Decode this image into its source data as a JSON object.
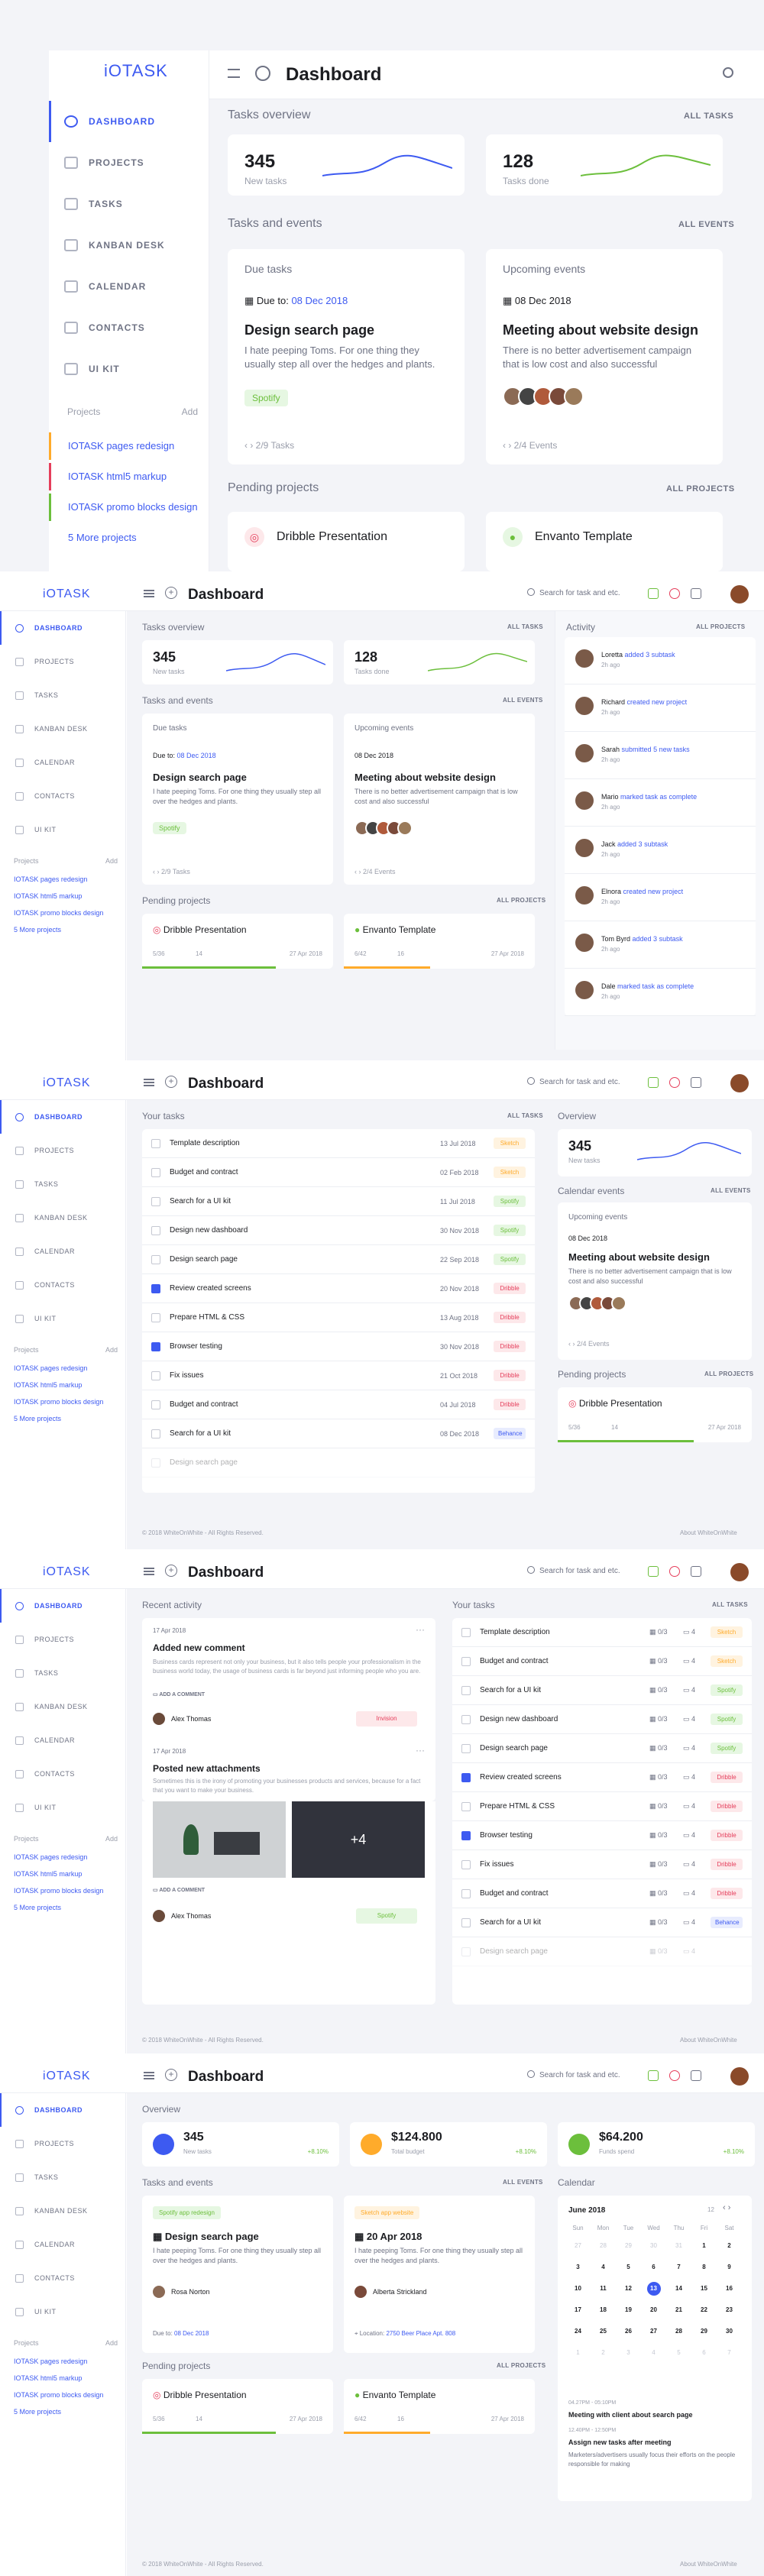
{
  "app": {
    "logo": "iOTASK"
  },
  "nav": {
    "dashboard": "DASHBOARD",
    "projects": "PROJECTS",
    "tasks": "TASKS",
    "kanban": "KANBAN DESK",
    "calendar": "CALENDAR",
    "contacts": "CONTACTS",
    "uikit": "UI KIT"
  },
  "sidebar": {
    "projects_label": "Projects",
    "add_label": "Add",
    "projects": [
      "IOTASK pages redesign",
      "IOTASK html5 markup",
      "IOTASK promo blocks design"
    ],
    "more": "5 More projects"
  },
  "header": {
    "title": "Dashboard",
    "search_placeholder": "Search for task and etc."
  },
  "overview": {
    "title": "Tasks overview",
    "link": "ALL TASKS",
    "new_tasks": {
      "value": "345",
      "label": "New tasks"
    },
    "tasks_done": {
      "value": "128",
      "label": "Tasks done"
    }
  },
  "events": {
    "title": "Tasks and events",
    "link": "ALL EVENTS",
    "due": {
      "heading": "Due tasks",
      "due_label": "Due to:",
      "due_date": "08 Dec 2018",
      "name": "Design search page",
      "desc": "I hate peeping Toms. For one thing they usually step all over the hedges and plants.",
      "tag": "Spotify",
      "pager": "2/9 Tasks"
    },
    "upcoming": {
      "heading": "Upcoming events",
      "date": "08 Dec 2018",
      "name": "Meeting about website design",
      "desc": "There is no better advertisement campaign that is low cost and also successful",
      "pager": "2/4 Events"
    }
  },
  "pending": {
    "title": "Pending projects",
    "link": "ALL PROJECTS",
    "items": [
      {
        "name": "Dribble Presentation",
        "files": "5/36",
        "comments": "14",
        "date": "27 Apr 2018"
      },
      {
        "name": "Envanto Template",
        "files": "6/42",
        "comments": "16",
        "date": "27 Apr 2018"
      }
    ]
  },
  "activity": {
    "title": "Activity",
    "filter": "ALL PROJECTS",
    "items": [
      {
        "name": "Loretta",
        "action": "added 3 subtask",
        "time": "2h ago"
      },
      {
        "name": "Richard",
        "action": "created new project",
        "time": "2h ago"
      },
      {
        "name": "Sarah",
        "action": "submitted 5 new tasks",
        "time": "2h ago"
      },
      {
        "name": "Mario",
        "action": "marked task as complete",
        "time": "2h ago"
      },
      {
        "name": "Jack",
        "action": "added 3 subtask",
        "time": "2h ago"
      },
      {
        "name": "Elnora",
        "action": "created new project",
        "time": "2h ago"
      },
      {
        "name": "Tom Byrd",
        "action": "added 3 subtask",
        "time": "2h ago"
      },
      {
        "name": "Dale",
        "action": "marked task as complete",
        "time": "2h ago"
      }
    ]
  },
  "footer": {
    "copy": "© 2018 WhiteOnWhite - All Rights Reserved.",
    "about": "About WhiteOnWhite"
  },
  "your_tasks": {
    "title": "Your tasks",
    "link": "ALL TASKS",
    "items": [
      {
        "name": "Template description",
        "date": "13 Jul 2018",
        "tag": "Sketch",
        "color": "orange",
        "checked": false
      },
      {
        "name": "Budget and contract",
        "date": "02 Feb 2018",
        "tag": "Sketch",
        "color": "orange",
        "checked": false
      },
      {
        "name": "Search for a UI kit",
        "date": "11 Jul 2018",
        "tag": "Spotify",
        "color": "green",
        "checked": false
      },
      {
        "name": "Design new dashboard",
        "date": "30 Nov 2018",
        "tag": "Spotify",
        "color": "green",
        "checked": false
      },
      {
        "name": "Design search page",
        "date": "22 Sep 2018",
        "tag": "Spotify",
        "color": "green",
        "checked": false
      },
      {
        "name": "Review created screens",
        "date": "20 Nov 2018",
        "tag": "Dribble",
        "color": "red",
        "checked": true
      },
      {
        "name": "Prepare HTML & CSS",
        "date": "13 Aug 2018",
        "tag": "Dribble",
        "color": "red",
        "checked": false
      },
      {
        "name": "Browser testing",
        "date": "30 Nov 2018",
        "tag": "Dribble",
        "color": "red",
        "checked": true
      },
      {
        "name": "Fix issues",
        "date": "21 Oct 2018",
        "tag": "Dribble",
        "color": "red",
        "checked": false
      },
      {
        "name": "Budget and contract",
        "date": "04 Jul 2018",
        "tag": "Dribble",
        "color": "red",
        "checked": false
      },
      {
        "name": "Search for a UI kit",
        "date": "08 Dec 2018",
        "tag": "Behance",
        "color": "blue",
        "checked": false
      },
      {
        "name": "Design search page",
        "date": "",
        "tag": "",
        "color": "green",
        "checked": false
      }
    ]
  },
  "side_overview": {
    "title": "Overview",
    "value": "345",
    "label": "New tasks",
    "cal_title": "Calendar events"
  },
  "recent": {
    "title": "Recent activity",
    "date1": "17 Apr 2018",
    "h1": "Added new comment",
    "p1": "Business cards represent not only your business, but it also tells people your professionalism in the business world today, the usage of business cards is far beyond just informing people who you are.",
    "add_comment": "ADD A COMMENT",
    "user": "Alex Thomas",
    "tag1": "Invision",
    "date2": "17 Apr 2018",
    "h2": "Posted new attachments",
    "p2": "Sometimes this is the irony of promoting your businesses products and services, because for a fact that you want to make your business.",
    "more_imgs": "+4",
    "tag2": "Spotify",
    "subtask_count": "0/3",
    "comment_count": "4"
  },
  "overview5": {
    "title": "Overview",
    "stats": [
      {
        "value": "345",
        "label": "New tasks",
        "delta": "+8.10%",
        "color": "#3d5af1"
      },
      {
        "value": "$124.800",
        "label": "Total budget",
        "delta": "+8.10%",
        "color": "#ffab2b"
      },
      {
        "value": "$64.200",
        "label": "Funds spend",
        "delta": "+8.10%",
        "color": "#6cbf3c"
      }
    ]
  },
  "events5": {
    "card1": {
      "tag": "Spotify app redesign",
      "name": "Design search page",
      "desc": "I hate peeping Toms. For one thing they usually step all over the hedges and plants.",
      "person": "Rosa Norton",
      "due_label": "Due to:",
      "due": "08 Dec 2018"
    },
    "card2": {
      "tag": "Sketch app website",
      "date": "20 Apr 2018",
      "desc": "I hate peeping Toms. For one thing they usually step all over the hedges and plants.",
      "person": "Alberta Strickland",
      "loc_label": "Location:",
      "loc": "2750 Beer Place Apt. 808"
    }
  },
  "calendar": {
    "title": "Calendar",
    "month": "June 2018",
    "day_num": "12",
    "days": [
      "Sun",
      "Mon",
      "Tue",
      "Wed",
      "Thu",
      "Fri",
      "Sat"
    ],
    "weeks": [
      [
        "27",
        "28",
        "29",
        "30",
        "31",
        "1",
        "2"
      ],
      [
        "3",
        "4",
        "5",
        "6",
        "7",
        "8",
        "9"
      ],
      [
        "10",
        "11",
        "12",
        "13",
        "14",
        "15",
        "16"
      ],
      [
        "17",
        "18",
        "19",
        "20",
        "21",
        "22",
        "23"
      ],
      [
        "24",
        "25",
        "26",
        "27",
        "28",
        "29",
        "30"
      ],
      [
        "1",
        "2",
        "3",
        "4",
        "5",
        "6",
        "7"
      ]
    ],
    "e1_time": "04.27PM - 05:10PM",
    "e1_name": "Meeting with client about search page",
    "e2_time": "12.40PM - 12:50PM",
    "e2_name": "Assign new tasks after meeting",
    "e2_desc": "Marketers/advertisers usually focus their efforts on the people responsible for making"
  },
  "colors": {
    "accent": "#3d5af1",
    "green": "#6cbf3c",
    "orange": "#ffab2b",
    "red": "#e53e5b"
  }
}
